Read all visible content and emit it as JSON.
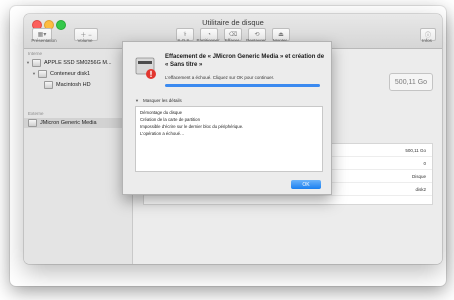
{
  "window": {
    "title": "Utilitaire de disque"
  },
  "toolbar": {
    "left_buttons": [
      {
        "name": "presentation",
        "label": "Présentation"
      },
      {
        "name": "volume",
        "label": "Volume"
      }
    ],
    "center_buttons": [
      {
        "name": "sos",
        "label": "S.O.S."
      },
      {
        "name": "partition",
        "label": "Partitionner"
      },
      {
        "name": "erase",
        "label": "Effacer"
      },
      {
        "name": "restore",
        "label": "Restaurer"
      },
      {
        "name": "mount",
        "label": "Monter"
      }
    ],
    "info_label": "Infos"
  },
  "sidebar": {
    "internal_header": "Interne",
    "external_header": "Externe",
    "items": [
      {
        "label": "APPLE SSD SM0256G M...",
        "level": 0,
        "expanded": true
      },
      {
        "label": "Conteneur disk1",
        "level": 1,
        "expanded": true
      },
      {
        "label": "Macintosh HD",
        "level": 2
      }
    ],
    "external_items": [
      {
        "label": "JMicron Generic Media",
        "selected": true
      }
    ]
  },
  "content": {
    "size_label": "500,11 Go",
    "info_values": [
      "500,11 Go",
      "0",
      "Disque",
      "disk2"
    ]
  },
  "sheet": {
    "title": "Effacement de « JMicron Generic Media » et création de « Sans titre »",
    "status": "L'effacement a échoué. Cliquez sur OK pour continuer.",
    "progress": 1.0,
    "details_toggle": "Masquer les détails",
    "details": [
      "Démontage du disque",
      "Création de la carte de partition",
      "Impossible d'écrire sur le dernier bloc du périphérique.",
      "L'opération a échoué…"
    ],
    "ok_label": "OK"
  },
  "colors": {
    "accent": "#1b7ff0",
    "progress": "#3b8af0"
  }
}
